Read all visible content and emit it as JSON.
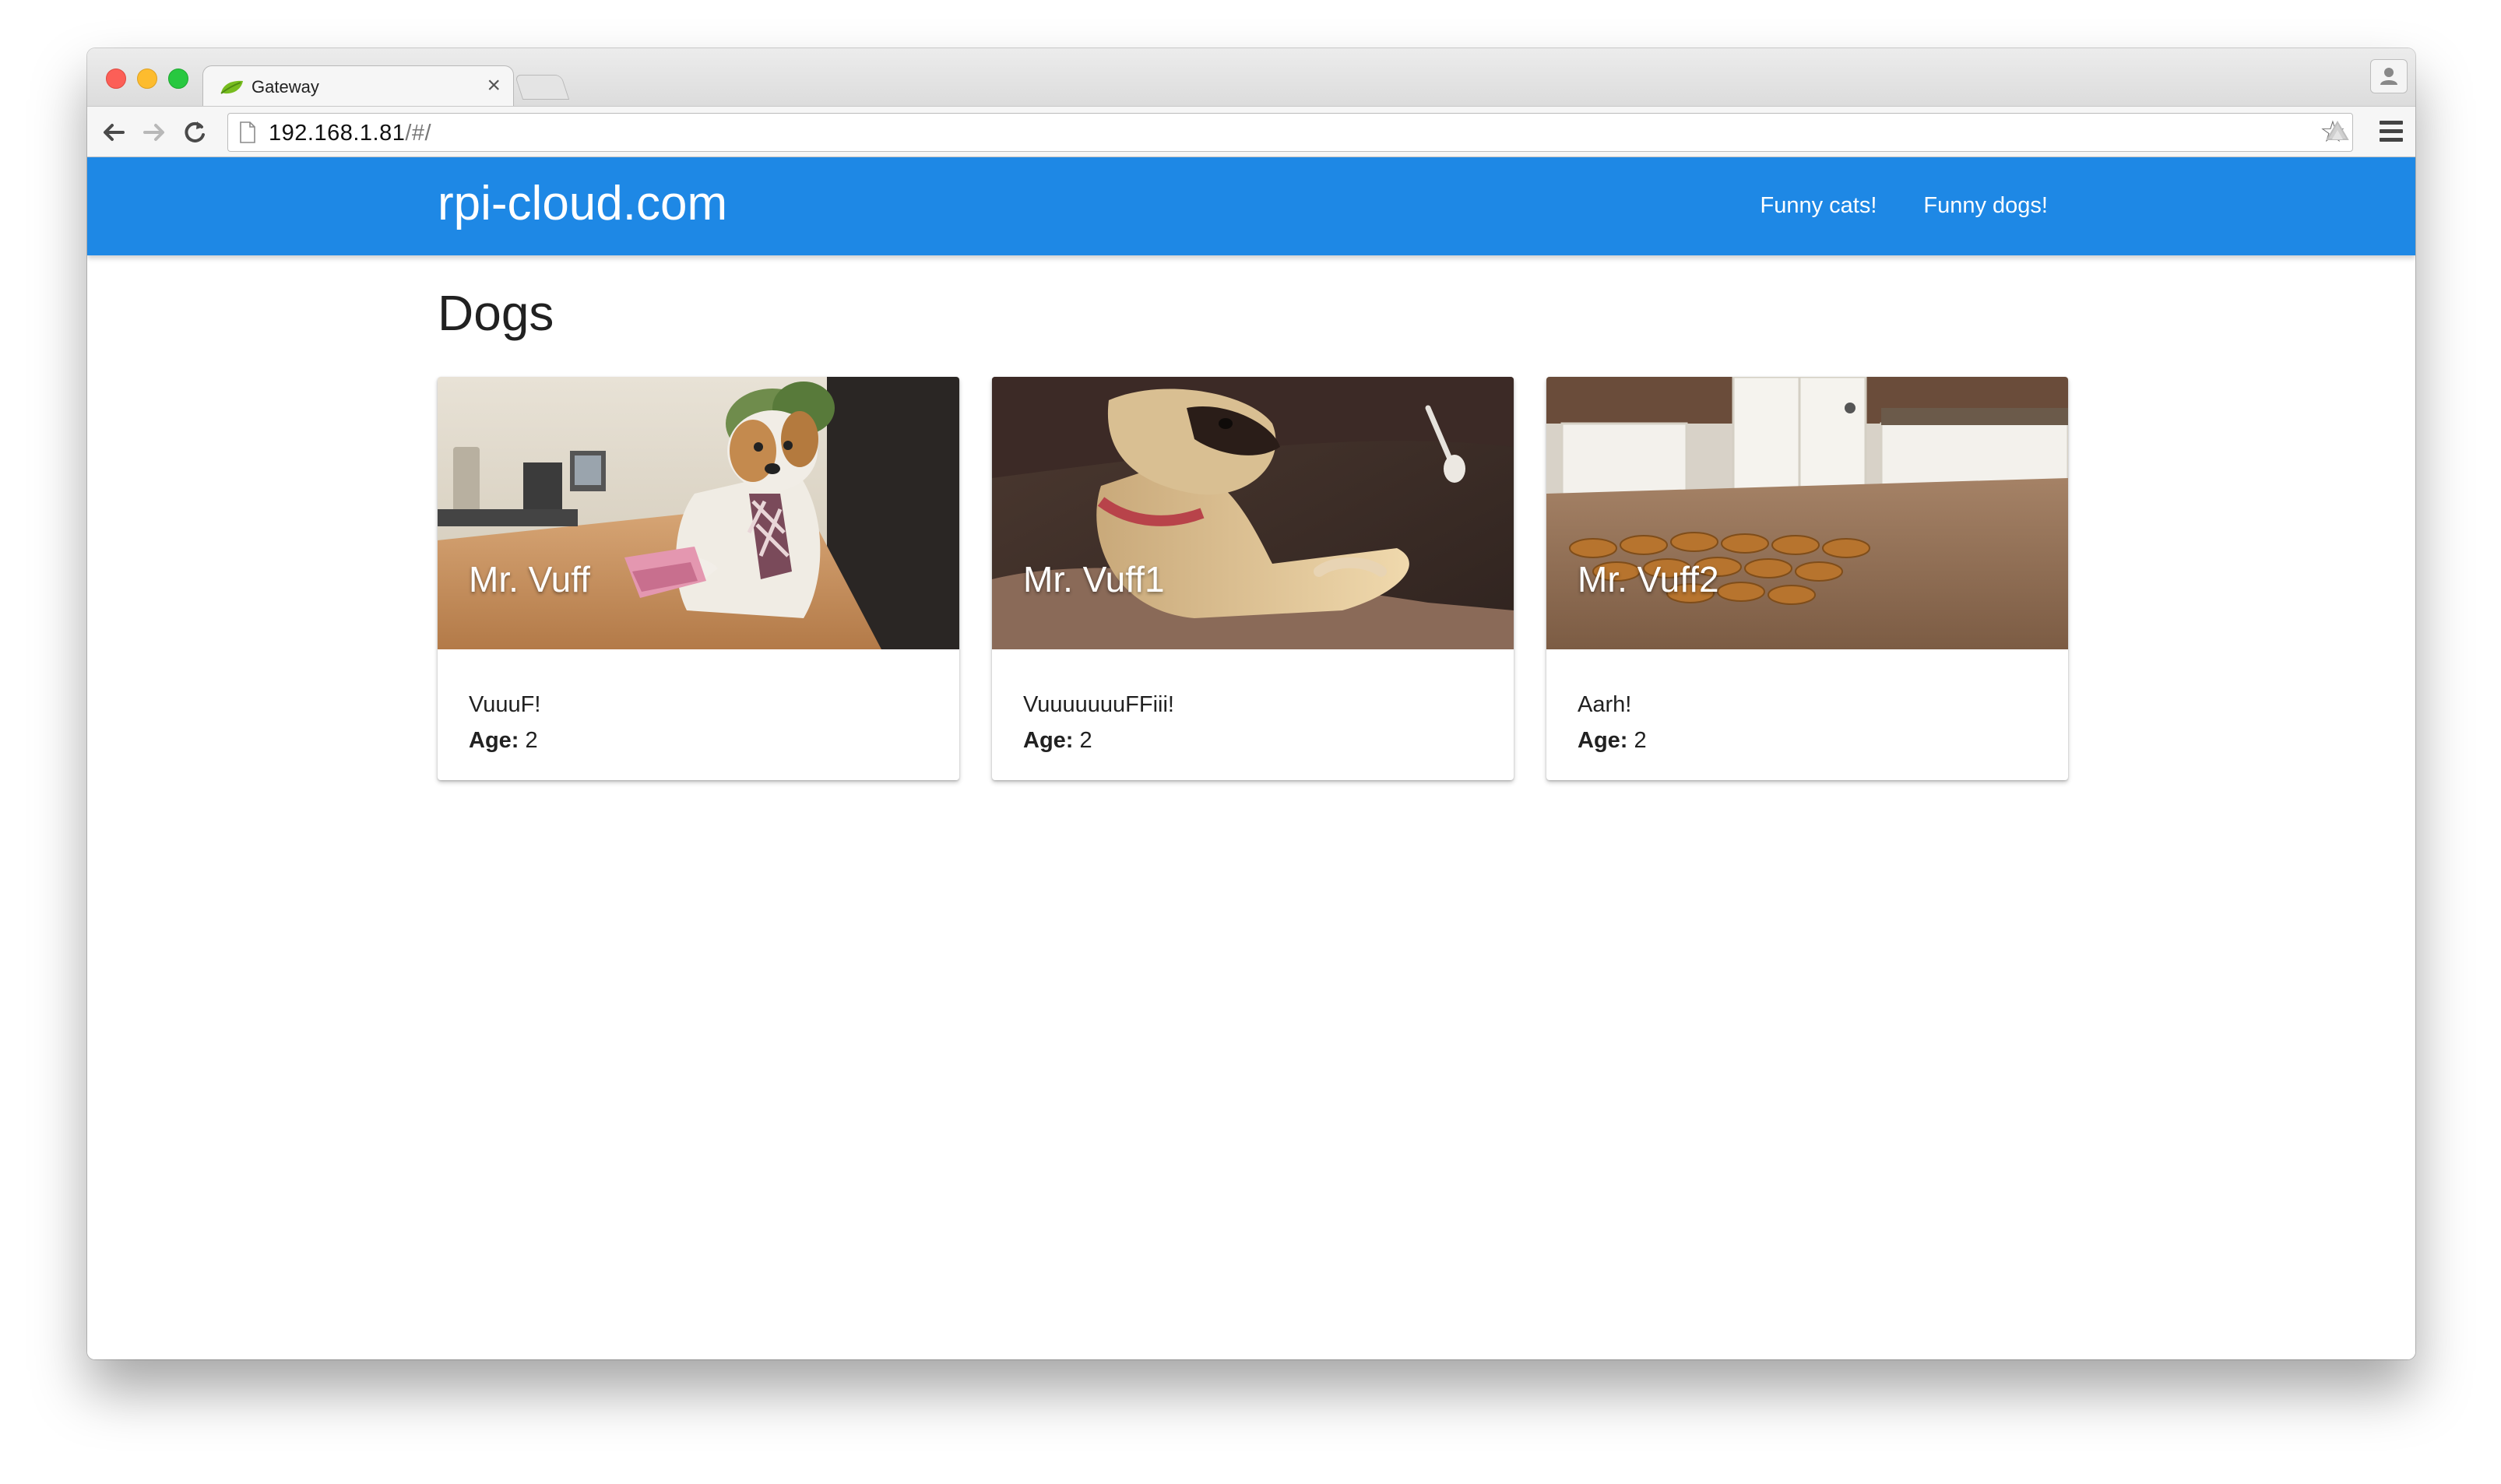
{
  "browser": {
    "tab_title": "Gateway",
    "tab_close": "×",
    "url_host": "192.168.1.81",
    "url_path": "/#/"
  },
  "site": {
    "brand": "rpi-cloud.com",
    "nav": [
      "Funny cats!",
      "Funny dogs!"
    ],
    "accent_color": "#1e88e5"
  },
  "page": {
    "title": "Dogs"
  },
  "age_label": "Age:",
  "cards": [
    {
      "name": "Mr. Vuff",
      "description": "VuuuF!",
      "age": "2"
    },
    {
      "name": "Mr. Vuff1",
      "description": "VuuuuuuuFFiii!",
      "age": "2"
    },
    {
      "name": "Mr. Vuff2",
      "description": "Aarh!",
      "age": "2"
    }
  ]
}
